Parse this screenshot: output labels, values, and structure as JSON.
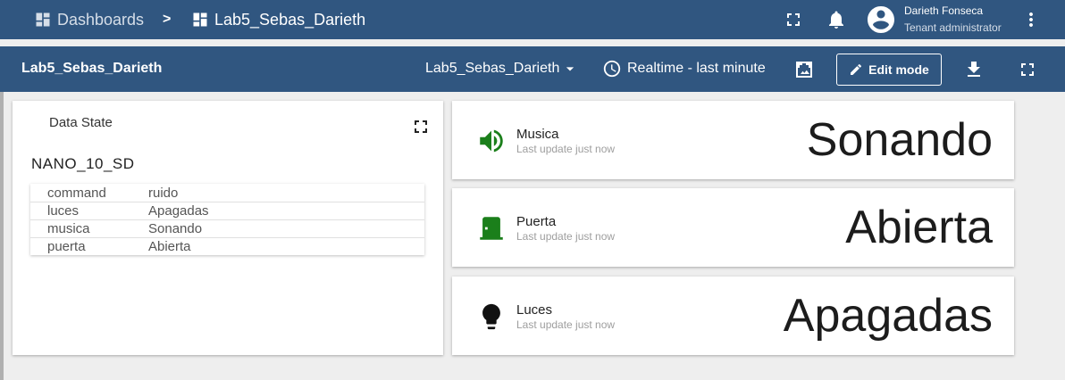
{
  "topbar": {
    "breadcrumb_root": "Dashboards",
    "breadcrumb_sep": ">",
    "breadcrumb_current": "Lab5_Sebas_Darieth",
    "user_name": "Darieth Fonseca",
    "user_role": "Tenant administrator",
    "icons": [
      "fullscreen-icon",
      "notifications-icon",
      "account-circle-icon",
      "more-vert-icon"
    ]
  },
  "dashbar": {
    "title": "Lab5_Sebas_Darieth",
    "state_selected": "Lab5_Sebas_Darieth",
    "timewindow": "Realtime - last minute",
    "edit_label": "Edit mode",
    "icons": [
      "image-export-icon",
      "download-icon",
      "fullscreen-icon"
    ]
  },
  "data_state": {
    "title": "Data State",
    "device": "NANO_10_SD",
    "rows": [
      {
        "key": "command",
        "value": "ruido"
      },
      {
        "key": "luces",
        "value": "Apagadas"
      },
      {
        "key": "musica",
        "value": "Sonando"
      },
      {
        "key": "puerta",
        "value": "Abierta"
      }
    ]
  },
  "value_cards": [
    {
      "label": "Musica",
      "sub": "Last update just now",
      "value": "Sonando",
      "icon": "volume-up-icon",
      "color": "#1b7f1b"
    },
    {
      "label": "Puerta",
      "sub": "Last update just now",
      "value": "Abierta",
      "icon": "door-icon",
      "color": "#1b7f1b"
    },
    {
      "label": "Luces",
      "sub": "Last update just now",
      "value": "Apagadas",
      "icon": "lightbulb-icon",
      "color": "#111111"
    }
  ],
  "colors": {
    "header": "#305680",
    "background": "#eeeeee",
    "on_green": "#1b7f1b"
  }
}
